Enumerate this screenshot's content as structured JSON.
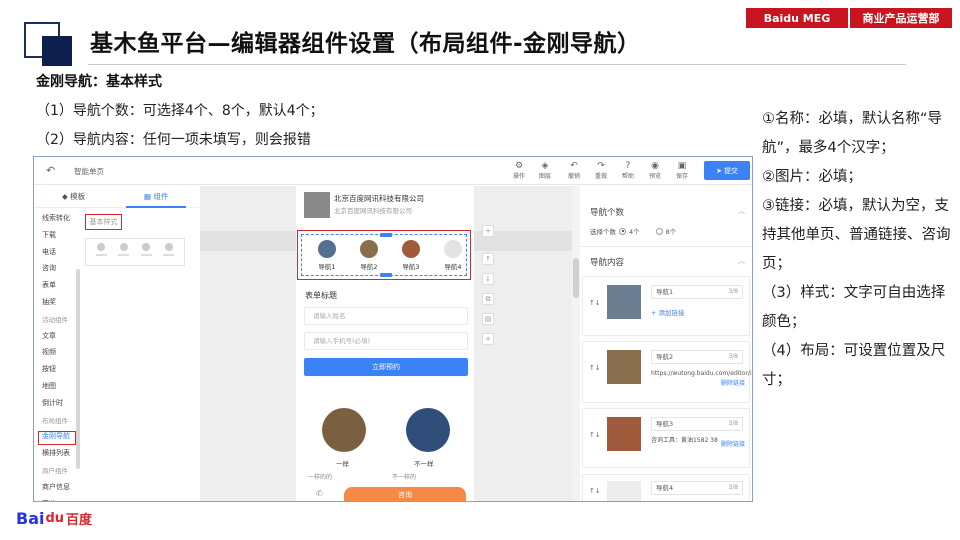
{
  "header": {
    "title": "基木鱼平台—编辑器组件设置（布局组件-金刚导航）",
    "tags": [
      "Baidu MEG",
      "商业产品运营部"
    ],
    "accent": "#c8141e",
    "navy": "#0e1f4f"
  },
  "intro": {
    "section_title": "金刚导航：基本样式",
    "rules": [
      "（1）导航个数：可选择4个、8个，默认4个；",
      "（2）导航内容：任何一项未填写，则会报错"
    ]
  },
  "notes": [
    "①名称：必填，默认名称“导航”，最多4个汉字；",
    "②图片：必填；",
    "③链接：必填，默认为空，支持其他单页、普通链接、咨询页；",
    "（3）样式：文字可自由选择颜色；",
    "（4）布局：可设置位置及尺寸；"
  ],
  "editor": {
    "toolbar": {
      "back_icon": "back-arrow-icon",
      "page_name": "智能单页",
      "tools": [
        "操作",
        "图层",
        "撤销",
        "重做",
        "帮助",
        "预览",
        "保存"
      ],
      "submit": "提交",
      "accent": "#3b82f6"
    },
    "left_panel": {
      "tabs": [
        "模板",
        "组件"
      ],
      "items": [
        {
          "label": "线索转化",
          "type": "item"
        },
        {
          "label": "下载",
          "type": "item"
        },
        {
          "label": "电话",
          "type": "item"
        },
        {
          "label": "咨询",
          "type": "item"
        },
        {
          "label": "表单",
          "type": "item"
        },
        {
          "label": "抽奖",
          "type": "item"
        },
        {
          "label": "活动组件",
          "type": "group"
        },
        {
          "label": "文章",
          "type": "item"
        },
        {
          "label": "视频",
          "type": "item"
        },
        {
          "label": "按钮",
          "type": "item"
        },
        {
          "label": "地图",
          "type": "item"
        },
        {
          "label": "倒计时",
          "type": "item"
        },
        {
          "label": "布局组件",
          "type": "group"
        },
        {
          "label": "金刚导航",
          "type": "selected"
        },
        {
          "label": "横排列表",
          "type": "item"
        },
        {
          "label": "商户组件",
          "type": "group"
        },
        {
          "label": "商户信息",
          "type": "item"
        },
        {
          "label": "营业",
          "type": "item"
        }
      ],
      "style_label": "基本样式"
    },
    "phone": {
      "biz_name": "北京百度网讯科技有限公司",
      "biz_sub": "北京百度网讯科技有限公司",
      "nav_items": [
        "导航1",
        "导航2",
        "导航3",
        "导航4"
      ],
      "form_title": "表单标题",
      "placeholder_name": "请输入姓名",
      "placeholder_phone": "请输入手机号(必填)",
      "submit_btn": "立即预约",
      "circle_labels": [
        "一样",
        "不一样"
      ],
      "circle_subs": [
        "一样的的",
        "不一样的"
      ],
      "cta": "咨询",
      "call": "电话"
    },
    "right_panel": {
      "count_title": "导航个数",
      "count_label": "选择个数",
      "options": [
        "4个",
        "8个"
      ],
      "content_title": "导航内容",
      "cards": [
        {
          "name": "导航1",
          "count": "3/8",
          "link": "+ 添加链接",
          "url": "",
          "del": ""
        },
        {
          "name": "导航2",
          "count": "3/8",
          "link": "",
          "url": "https://wutong.baidu.com/editor/index...",
          "del": "删除链接"
        },
        {
          "name": "导航3",
          "count": "3/8",
          "link": "",
          "url": "咨询工具：黄油1582 38",
          "del": "删除链接"
        },
        {
          "name": "导航4",
          "count": "3/8",
          "link": "",
          "url": "",
          "del": ""
        }
      ]
    }
  },
  "footer": {
    "logo_bai": "Bai",
    "logo_du": "du",
    "logo_cn": "百度"
  }
}
